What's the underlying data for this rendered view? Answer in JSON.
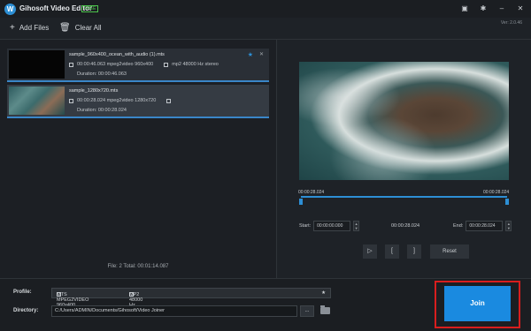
{
  "app": {
    "logo_letter": "W",
    "title": "Gihosoft Video Editor",
    "badge": "FREE",
    "version": "Ver: 2.0.46"
  },
  "titlebar_icons": [
    "bookmark-icon",
    "gear-icon",
    "minimize-icon",
    "close-icon"
  ],
  "toolbar": {
    "add_files": "Add Files",
    "clear_all": "Clear All"
  },
  "files": [
    {
      "name": "sample_960x400_ocean_with_audio (1).mts",
      "video": "00:00:46.063 mpeg2video 960x400",
      "audio": "mp2 48000 Hz stereo",
      "duration_label": "Duration:",
      "duration": "00:00:46.063",
      "starred": true
    },
    {
      "name": "sample_1280x720.mts",
      "video": "00:00:28.024 mpeg2video 1280x720",
      "audio": "",
      "duration_label": "Duration:",
      "duration": "00:00:28.024",
      "starred": false
    }
  ],
  "stats": "File: 2  Total: 00:01:14.087",
  "timeline": {
    "left_time": "00:00:28.024",
    "right_time": "00:00:28.024",
    "start_label": "Start:",
    "start_value": "00:00:00.000",
    "mid_time": "00:00:28.024",
    "end_label": "End:",
    "end_value": "00:00:28.024"
  },
  "controls": {
    "play": "▷",
    "mark_in": "[",
    "mark_out": "]",
    "reset": "Reset"
  },
  "output": {
    "profile_label": "Profile:",
    "profile_video": "MTS MPEG2VIDEO 960x400",
    "profile_audio": "MP2 48000 Hz stereo",
    "directory_label": "Directory:",
    "directory_value": "C:/Users/ADMIN/Documents/Gihosoft/Video Joiner",
    "browse": "...",
    "join": "Join"
  },
  "colors": {
    "accent": "#2d8fd5",
    "highlight_border": "#d81e1e",
    "background": "#1e2227"
  }
}
